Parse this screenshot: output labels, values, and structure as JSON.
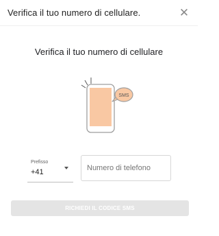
{
  "dialog": {
    "title": "Verifica il tuo numero di cellulare.",
    "close_symbol": "✕",
    "heading": "Verifica il tuo numero di cellulare",
    "illustration": {
      "icon": "phone-sms-icon",
      "bubble_text": "SMS",
      "colors": {
        "screen": "#f9c8a3",
        "bubble": "#f9c8a3",
        "outline": "#9e9e9e"
      }
    },
    "prefix": {
      "label": "Prefisso",
      "value": "+41"
    },
    "phone": {
      "placeholder": "Numero di telefono",
      "value": ""
    },
    "submit_label": "RICHIEDI IL CODICE SMS"
  }
}
